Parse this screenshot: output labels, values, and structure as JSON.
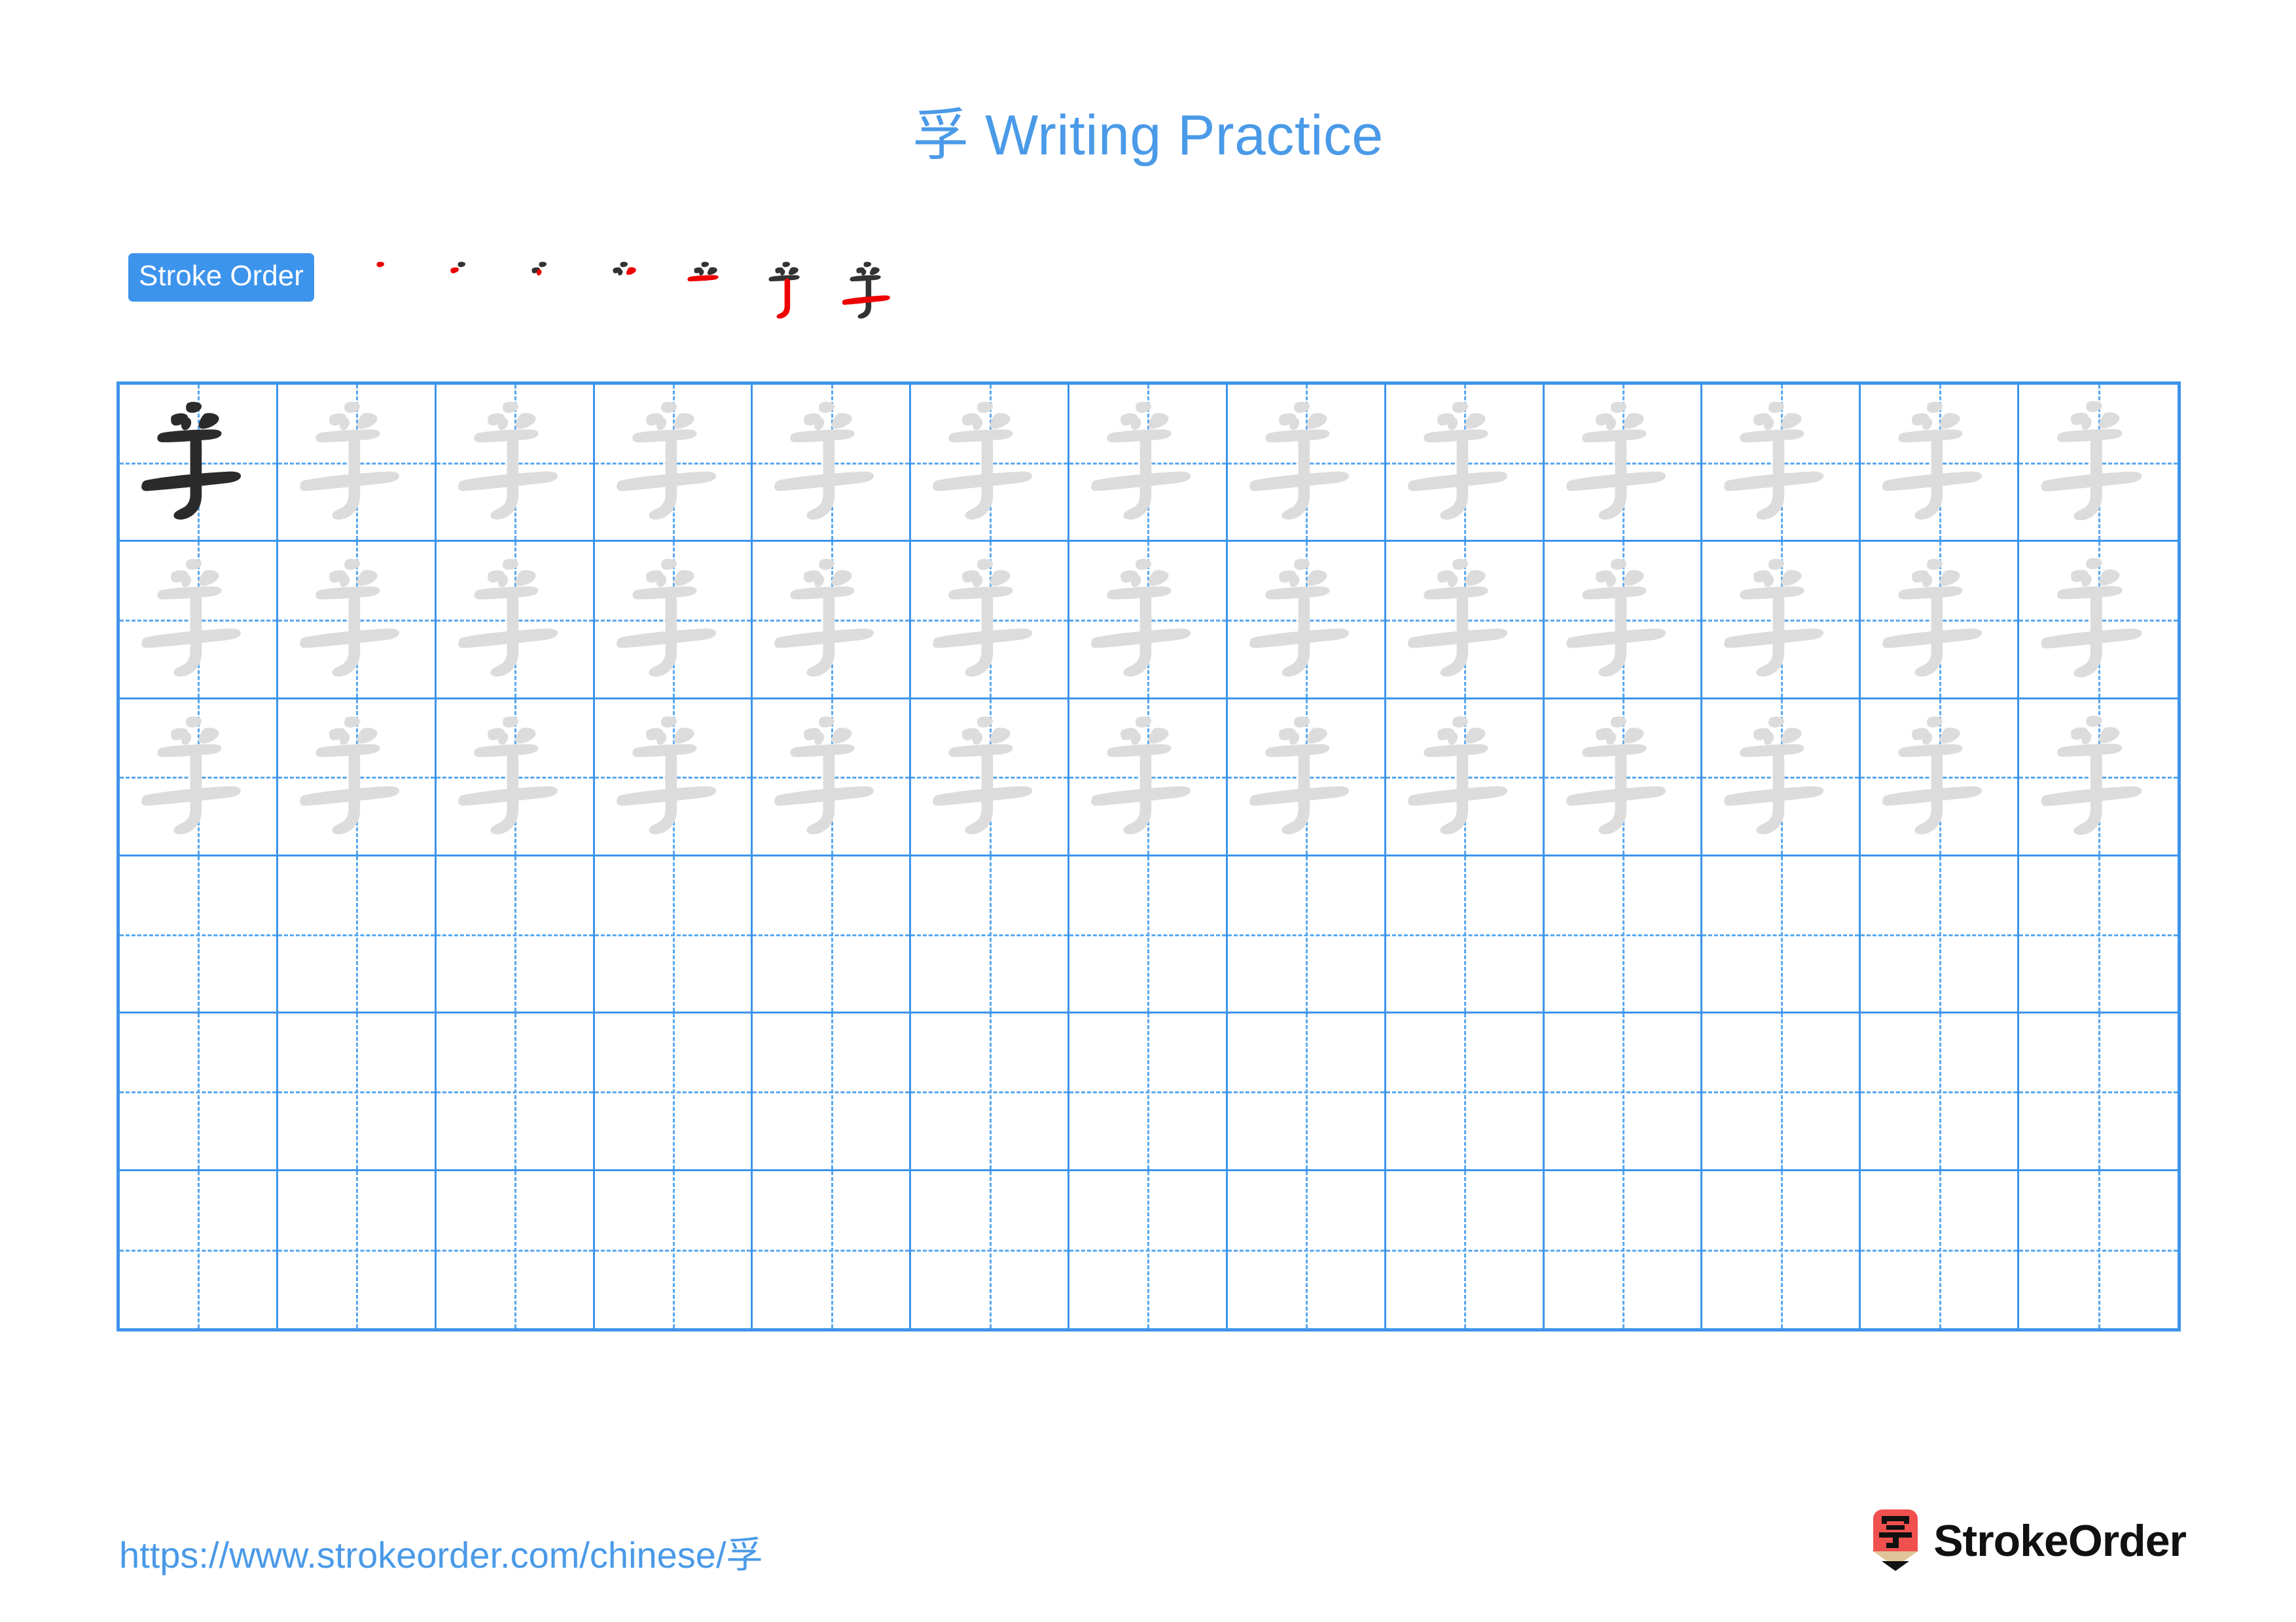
{
  "page": {
    "character": "孚",
    "title": "孚 Writing Practice",
    "title_color": "#4a9ae8",
    "background": "#ffffff"
  },
  "stroke_order": {
    "badge_label": "Stroke Order",
    "badge_bg": "#3d94ec",
    "badge_text_color": "#ffffff",
    "new_stroke_color": "#ee0000",
    "prev_stroke_color": "#333333",
    "stroke_count": 7,
    "steps": [
      {
        "index": 1,
        "new_stroke": 1,
        "strokes_shown": 1
      },
      {
        "index": 2,
        "new_stroke": 2,
        "strokes_shown": 2
      },
      {
        "index": 3,
        "new_stroke": 3,
        "strokes_shown": 3
      },
      {
        "index": 4,
        "new_stroke": 4,
        "strokes_shown": 4
      },
      {
        "index": 5,
        "new_stroke": 5,
        "strokes_shown": 5
      },
      {
        "index": 6,
        "new_stroke": 6,
        "strokes_shown": 6
      },
      {
        "index": 7,
        "new_stroke": 7,
        "strokes_shown": 7
      }
    ]
  },
  "grid": {
    "columns": 13,
    "rows": 6,
    "line_color": "#3d94ec",
    "guide_color": "#5aa8ee",
    "dark_char_color": "#2b2b2b",
    "light_char_color": "#dcdcdc",
    "filled_rows": 3,
    "empty_rows": 3,
    "first_cell_style": "dark",
    "other_filled_cell_style": "light",
    "cells": [
      [
        "dark",
        "light",
        "light",
        "light",
        "light",
        "light",
        "light",
        "light",
        "light",
        "light",
        "light",
        "light",
        "light"
      ],
      [
        "light",
        "light",
        "light",
        "light",
        "light",
        "light",
        "light",
        "light",
        "light",
        "light",
        "light",
        "light",
        "light"
      ],
      [
        "light",
        "light",
        "light",
        "light",
        "light",
        "light",
        "light",
        "light",
        "light",
        "light",
        "light",
        "light",
        "light"
      ],
      [
        "empty",
        "empty",
        "empty",
        "empty",
        "empty",
        "empty",
        "empty",
        "empty",
        "empty",
        "empty",
        "empty",
        "empty",
        "empty"
      ],
      [
        "empty",
        "empty",
        "empty",
        "empty",
        "empty",
        "empty",
        "empty",
        "empty",
        "empty",
        "empty",
        "empty",
        "empty",
        "empty"
      ],
      [
        "empty",
        "empty",
        "empty",
        "empty",
        "empty",
        "empty",
        "empty",
        "empty",
        "empty",
        "empty",
        "empty",
        "empty",
        "empty"
      ]
    ]
  },
  "footer": {
    "url": "https://www.strokeorder.com/chinese/孚",
    "url_color": "#4a9ae8",
    "brand_name": "StrokeOrder",
    "brand_icon_char": "字",
    "brand_icon_body_color": "#f0514e",
    "brand_icon_wood_color": "#e0c49a",
    "brand_icon_tip_color": "#111111"
  }
}
